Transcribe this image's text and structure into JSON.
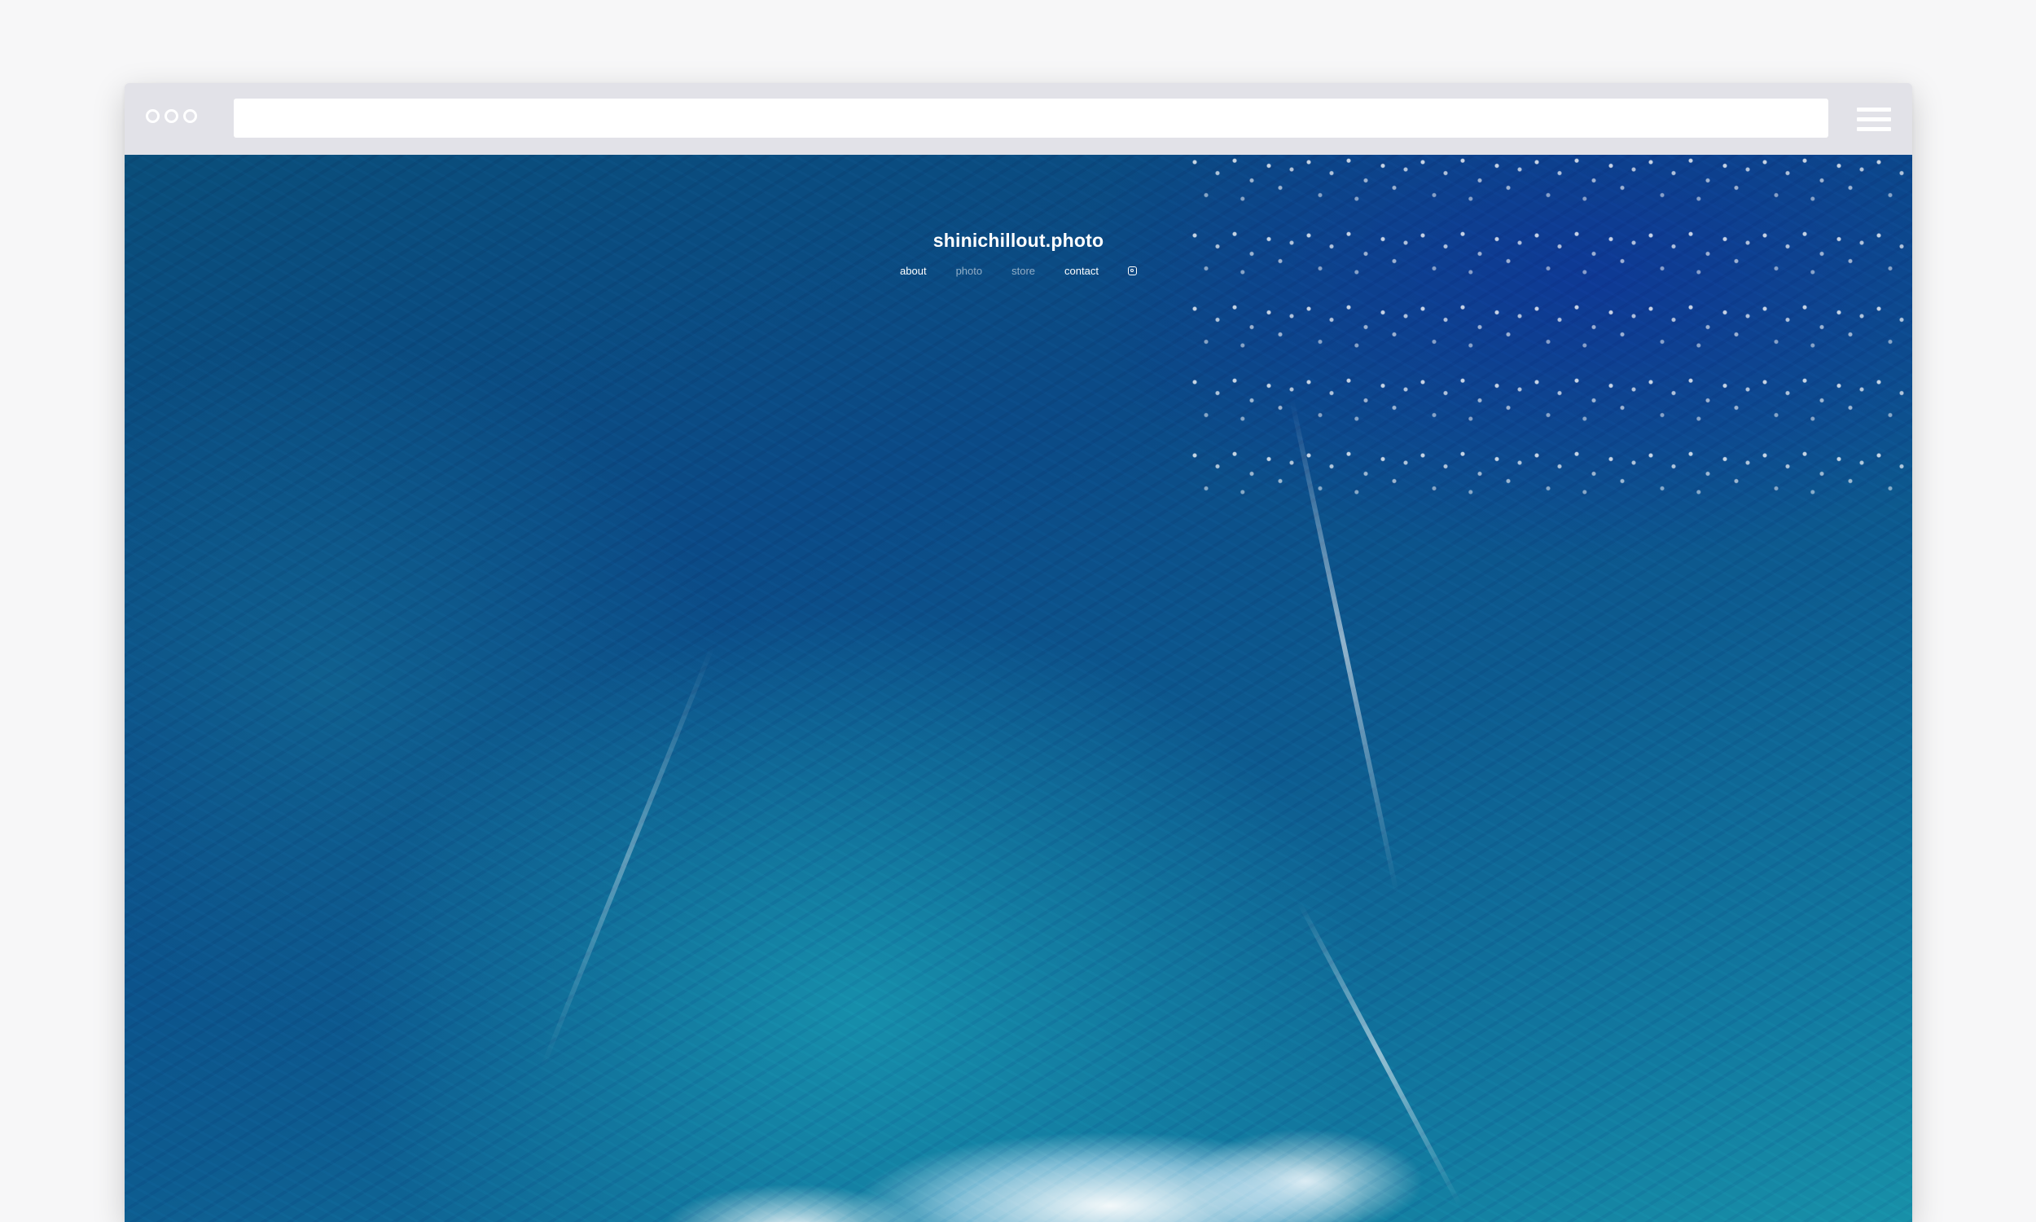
{
  "browser": {
    "address_bar": {
      "value": "",
      "placeholder": ""
    },
    "menu_icon": "hamburger-menu-icon",
    "window_control_icons": [
      "window-dot-icon",
      "window-dot-icon",
      "window-dot-icon"
    ]
  },
  "site": {
    "title": "shinichillout.photo",
    "nav": {
      "about": "about",
      "photo": "photo",
      "store": "store",
      "contact": "contact",
      "instagram_icon": "instagram-icon"
    },
    "hero_image": "ocean-aerial-photo"
  },
  "colors": {
    "page_background": "#f7f7f8",
    "browser_chrome": "#e2e2e8",
    "nav_text": "#ffffff",
    "ocean_deep": "#0b4a86",
    "ocean_teal": "#1890a8"
  }
}
